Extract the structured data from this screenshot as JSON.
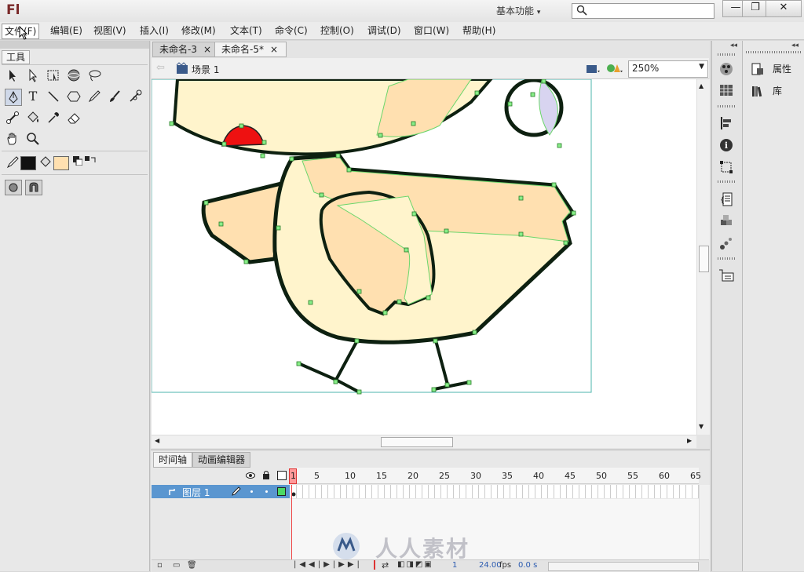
{
  "app": {
    "logo": "Fl",
    "workspace": "基本功能",
    "search_placeholder": ""
  },
  "window_buttons": [
    "—",
    "❐",
    "✕"
  ],
  "menu": [
    "文件(F)",
    "编辑(E)",
    "视图(V)",
    "插入(I)",
    "修改(M)",
    "文本(T)",
    "命令(C)",
    "控制(O)",
    "调试(D)",
    "窗口(W)",
    "帮助(H)"
  ],
  "tools": {
    "panel_title": "工具"
  },
  "tabs": [
    {
      "label": "未命名-3",
      "close": "×"
    },
    {
      "label": "未命名-5*",
      "close": "×"
    }
  ],
  "edit_bar": {
    "scene": "场景 1",
    "zoom": "250%"
  },
  "timeline": {
    "tabs": [
      "时间轴",
      "动画编辑器"
    ],
    "ruler_labels": [
      "1",
      "5",
      "10",
      "15",
      "20",
      "25",
      "30",
      "35",
      "40",
      "45",
      "50",
      "55",
      "60",
      "65"
    ],
    "layer_name": "图层 1",
    "current_frame": "1",
    "fps": "24.00",
    "fps_unit": "fps",
    "time": "0.0 s"
  },
  "right_panel": {
    "items": [
      "属性",
      "库"
    ]
  },
  "watermark": "人人素材",
  "colors": {
    "stroke": "#000000",
    "fill": "#ffe0b0",
    "accent_selection": "#33cc33"
  }
}
